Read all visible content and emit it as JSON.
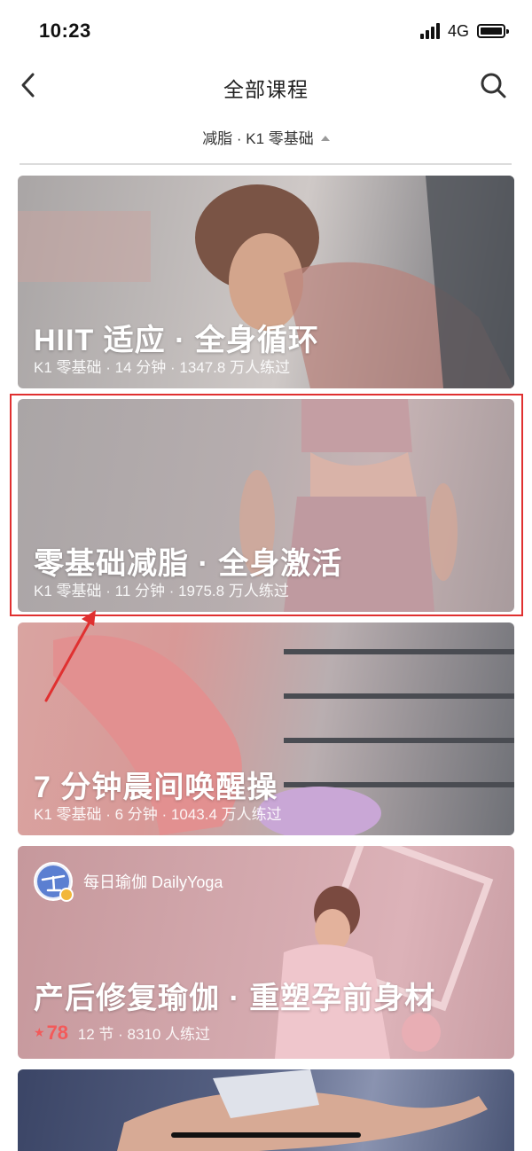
{
  "status_bar": {
    "time": "10:23",
    "network": "4G"
  },
  "nav": {
    "title": "全部课程"
  },
  "filter": {
    "label": "减脂 · K1 零基础"
  },
  "courses": [
    {
      "title": "HIIT 适应 · 全身循环",
      "meta": "K1 零基础 · 14 分钟 · 1347.8 万人练过"
    },
    {
      "title": "零基础减脂 · 全身激活",
      "meta": "K1 零基础 · 11 分钟 · 1975.8 万人练过"
    },
    {
      "title": "7 分钟晨间唤醒操",
      "meta": "K1 零基础 · 6 分钟 · 1043.4 万人练过"
    },
    {
      "provider": "每日瑜伽 DailyYoga",
      "title": "产后修复瑜伽 · 重塑孕前身材",
      "price": "78",
      "meta": "12 节 · 8310 人练过"
    }
  ],
  "colors": {
    "annotation_red": "#e03030",
    "price_red": "#f35a5a"
  },
  "icons": [
    "back-chevron-icon",
    "search-icon",
    "caret-up-icon",
    "signal-icon",
    "battery-icon",
    "dailyyoga-logo-icon"
  ]
}
